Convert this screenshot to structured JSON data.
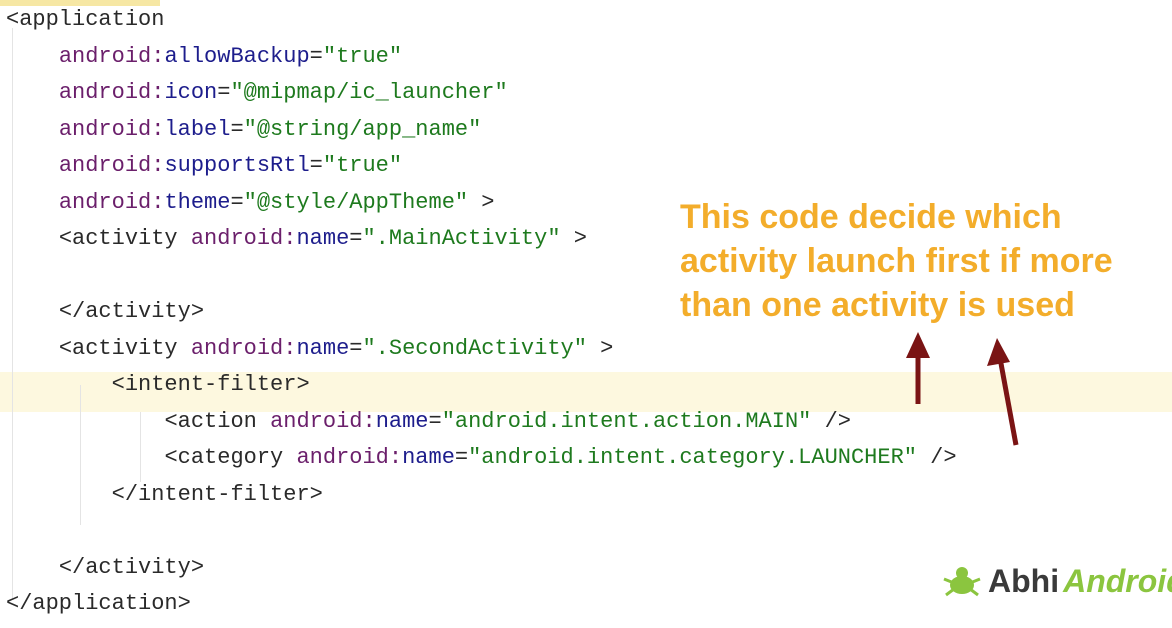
{
  "code_lines": [
    {
      "indent": "",
      "parts": [
        [
          "tag",
          "<application"
        ]
      ]
    },
    {
      "indent": "    ",
      "parts": [
        [
          "ns",
          "android:"
        ],
        [
          "attr",
          "allowBackup"
        ],
        [
          "tag",
          "="
        ],
        [
          "val",
          "\"true\""
        ]
      ]
    },
    {
      "indent": "    ",
      "parts": [
        [
          "ns",
          "android:"
        ],
        [
          "attr",
          "icon"
        ],
        [
          "tag",
          "="
        ],
        [
          "val",
          "\"@mipmap/ic_launcher\""
        ]
      ]
    },
    {
      "indent": "    ",
      "parts": [
        [
          "ns",
          "android:"
        ],
        [
          "attr",
          "label"
        ],
        [
          "tag",
          "="
        ],
        [
          "val",
          "\"@string/app_name\""
        ]
      ]
    },
    {
      "indent": "    ",
      "parts": [
        [
          "ns",
          "android:"
        ],
        [
          "attr",
          "supportsRtl"
        ],
        [
          "tag",
          "="
        ],
        [
          "val",
          "\"true\""
        ]
      ]
    },
    {
      "indent": "    ",
      "parts": [
        [
          "ns",
          "android:"
        ],
        [
          "attr",
          "theme"
        ],
        [
          "tag",
          "="
        ],
        [
          "val",
          "\"@style/AppTheme\""
        ],
        [
          "tag",
          " >"
        ]
      ]
    },
    {
      "indent": "    ",
      "parts": [
        [
          "tag",
          "<activity "
        ],
        [
          "ns",
          "android:"
        ],
        [
          "attr",
          "name"
        ],
        [
          "tag",
          "="
        ],
        [
          "val",
          "\".MainActivity\""
        ],
        [
          "tag",
          " >"
        ]
      ]
    },
    {
      "indent": "",
      "parts": []
    },
    {
      "indent": "    ",
      "parts": [
        [
          "tag",
          "</activity>"
        ]
      ]
    },
    {
      "indent": "    ",
      "parts": [
        [
          "tag",
          "<activity "
        ],
        [
          "ns",
          "android:"
        ],
        [
          "attr",
          "name"
        ],
        [
          "tag",
          "="
        ],
        [
          "val",
          "\".SecondActivity\""
        ],
        [
          "tag",
          " >"
        ]
      ]
    },
    {
      "indent": "        ",
      "parts": [
        [
          "tag",
          "<intent-filter>"
        ]
      ]
    },
    {
      "indent": "            ",
      "parts": [
        [
          "tag",
          "<action "
        ],
        [
          "ns",
          "android:"
        ],
        [
          "attr",
          "name"
        ],
        [
          "tag",
          "="
        ],
        [
          "val",
          "\"android.intent.action.MAIN\""
        ],
        [
          "tag",
          " />"
        ]
      ]
    },
    {
      "indent": "            ",
      "parts": [
        [
          "tag",
          "<category "
        ],
        [
          "ns",
          "android:"
        ],
        [
          "attr",
          "name"
        ],
        [
          "tag",
          "="
        ],
        [
          "val",
          "\"android.intent.category.LAUNCHER\""
        ],
        [
          "tag",
          " />"
        ]
      ]
    },
    {
      "indent": "        ",
      "parts": [
        [
          "tag",
          "</intent-filter>"
        ]
      ]
    },
    {
      "indent": "",
      "parts": []
    },
    {
      "indent": "    ",
      "parts": [
        [
          "tag",
          "</activity>"
        ]
      ]
    },
    {
      "indent": "",
      "parts": [
        [
          "tag",
          "</application>"
        ]
      ]
    }
  ],
  "annotation": {
    "line1": "This code decide which",
    "line2": "activity launch first if more",
    "line3": "than one activity is used"
  },
  "logo": {
    "part1": "Abhi",
    "part2": "Android"
  },
  "colors": {
    "annotation": "#f3ad2b",
    "arrow": "#7a1414",
    "current_line": "#fdf8df"
  }
}
